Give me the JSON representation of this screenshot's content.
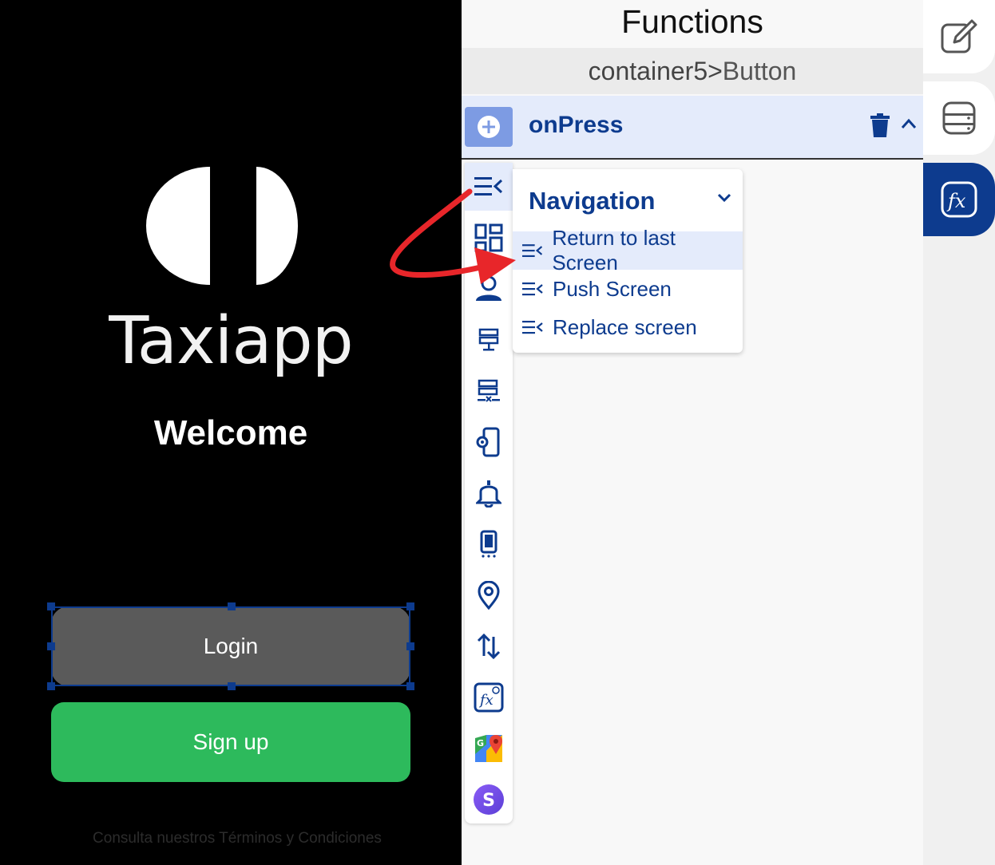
{
  "preview": {
    "brand_name": "Taxiapp",
    "welcome_text": "Welcome",
    "login_button": "Login",
    "signup_button": "Sign up",
    "terms_text": "Consulta nuestros Términos y Condiciones"
  },
  "panel": {
    "title": "Functions",
    "breadcrumb": {
      "parent": "container5",
      "separator": ">",
      "child": "Button"
    },
    "event": {
      "name": "onPress"
    },
    "categories": [
      {
        "icon": "navigation-icon"
      },
      {
        "icon": "grid-icon"
      },
      {
        "icon": "user-icon"
      },
      {
        "icon": "database-icon"
      },
      {
        "icon": "database-remove-icon"
      },
      {
        "icon": "device-settings-icon"
      },
      {
        "icon": "bell-icon"
      },
      {
        "icon": "mobile-icon"
      },
      {
        "icon": "location-pin-icon"
      },
      {
        "icon": "transfer-arrows-icon"
      },
      {
        "icon": "custom-function-icon"
      },
      {
        "icon": "google-maps-icon"
      },
      {
        "icon": "stripe-icon"
      }
    ],
    "dropdown": {
      "title": "Navigation",
      "items": [
        {
          "label": "Return to last Screen"
        },
        {
          "label": "Push Screen"
        },
        {
          "label": "Replace screen"
        }
      ]
    }
  },
  "right_toolbar": {
    "tabs": [
      {
        "icon": "edit-icon"
      },
      {
        "icon": "database-icon"
      },
      {
        "icon": "function-icon"
      }
    ]
  },
  "colors": {
    "accent": "#0d3b8e",
    "highlight": "#e4ebfb",
    "signup_green": "#2dba5c",
    "login_gray": "#5a5a5a",
    "annotation_red": "#e8262a"
  }
}
